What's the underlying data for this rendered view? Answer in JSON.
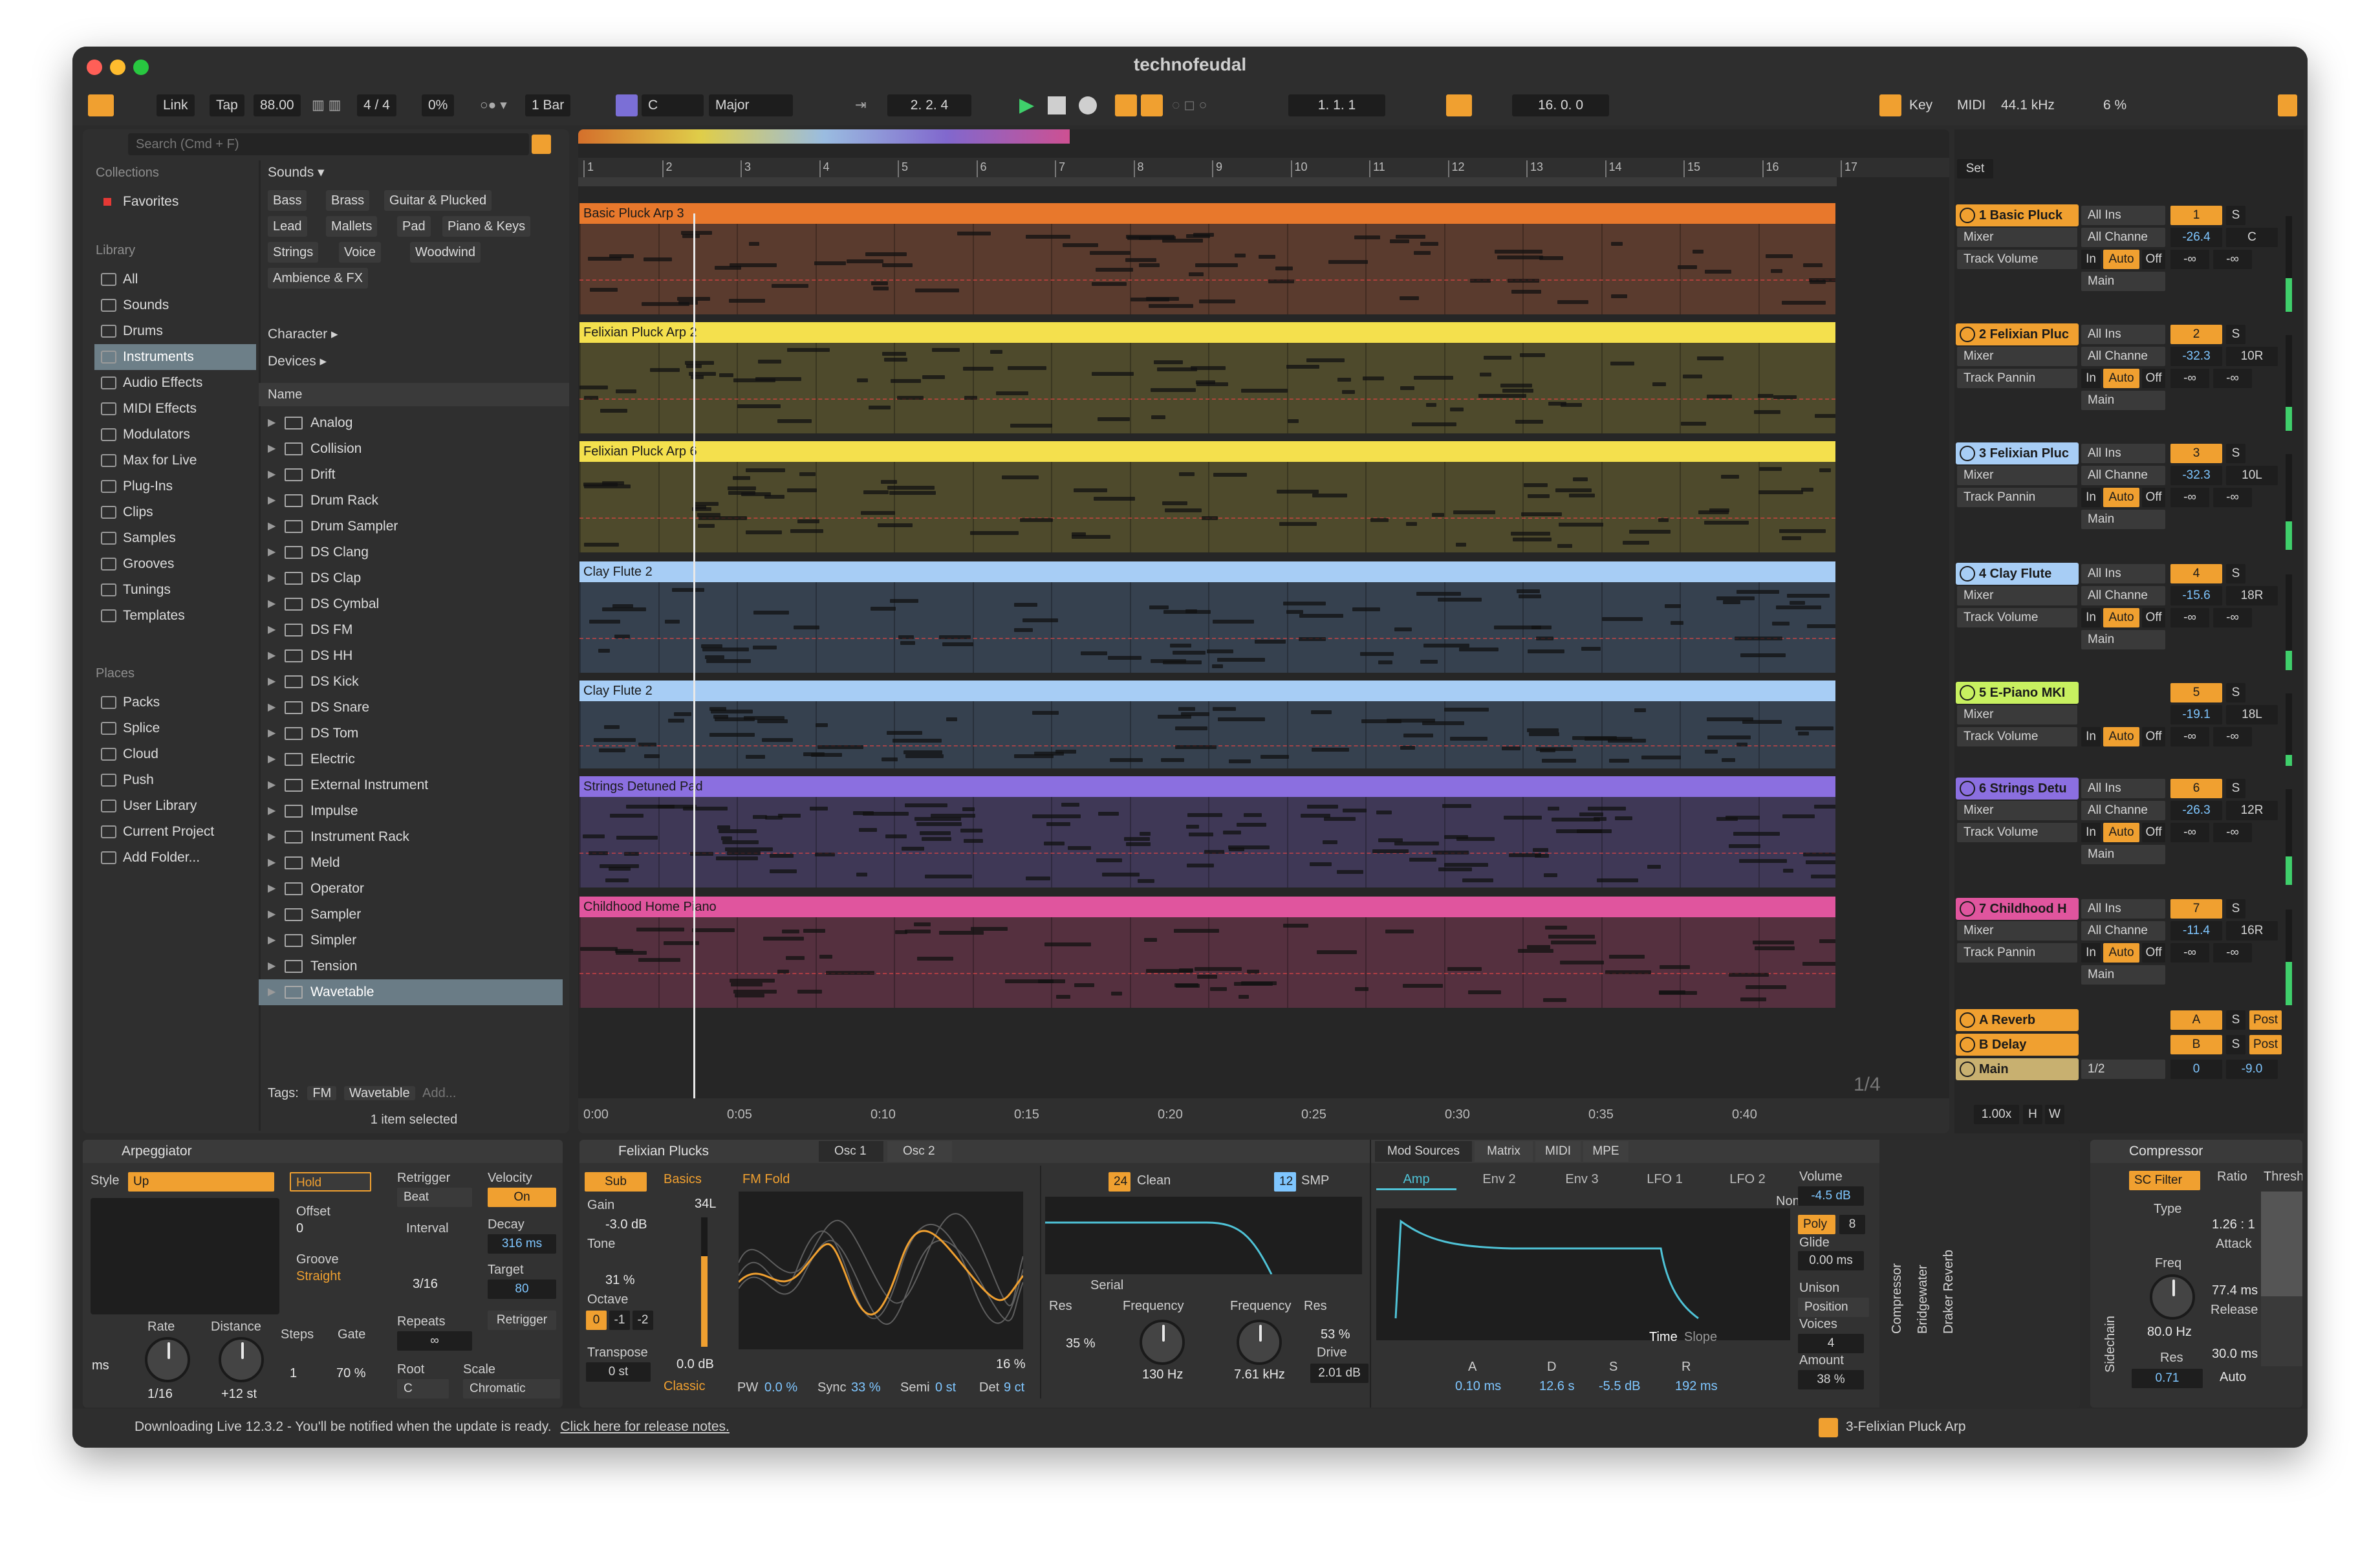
{
  "window": {
    "title": "technofeudal"
  },
  "control_bar": {
    "link": "Link",
    "tap": "Tap",
    "tempo": "88.00",
    "signature": "4 / 4",
    "swing": "0%",
    "quantize": "1 Bar",
    "key": "C",
    "scale": "Major",
    "position": "2.  2.  4",
    "loop_start": "1.  1.  1",
    "loop_length": "16.  0.  0",
    "key_map": "Key",
    "midi_map": "MIDI",
    "sample_rate": "44.1 kHz",
    "cpu": "6 %"
  },
  "browser": {
    "search_placeholder": "Search (Cmd + F)",
    "collections_head": "Collections",
    "favorites": "Favorites",
    "library_head": "Library",
    "library": [
      "All",
      "Sounds",
      "Drums",
      "Instruments",
      "Audio Effects",
      "MIDI Effects",
      "Modulators",
      "Max for Live",
      "Plug-Ins",
      "Clips",
      "Samples",
      "Grooves",
      "Tunings",
      "Templates"
    ],
    "places_head": "Places",
    "places": [
      "Packs",
      "Splice",
      "Cloud",
      "Push",
      "User Library",
      "Current Project",
      "Add Folder..."
    ],
    "sounds_head": "Sounds ▾",
    "sound_chips": [
      "Bass",
      "Brass",
      "Guitar & Plucked",
      "Lead",
      "Mallets",
      "Pad",
      "Piano & Keys",
      "Strings",
      "Voice",
      "Woodwind",
      "Ambience & FX"
    ],
    "character": "Character ▸",
    "devices_head": "Devices ▸",
    "name_col": "Name",
    "items": [
      "Analog",
      "Collision",
      "Drift",
      "Drum Rack",
      "Drum Sampler",
      "DS Clang",
      "DS Clap",
      "DS Cymbal",
      "DS FM",
      "DS HH",
      "DS Kick",
      "DS Snare",
      "DS Tom",
      "Electric",
      "External Instrument",
      "Impulse",
      "Instrument Rack",
      "Meld",
      "Operator",
      "Sampler",
      "Simpler",
      "Tension",
      "Wavetable"
    ],
    "tags_label": "Tags:",
    "tags": [
      "FM",
      "Wavetable",
      "Add..."
    ],
    "selection": "1 item selected"
  },
  "arrangement": {
    "bars": [
      "1",
      "2",
      "3",
      "4",
      "5",
      "6",
      "7",
      "8",
      "9",
      "10",
      "11",
      "12",
      "13",
      "14",
      "15",
      "16",
      "17"
    ],
    "times": [
      "0:00",
      "0:05",
      "0:10",
      "0:15",
      "0:20",
      "0:25",
      "0:30",
      "0:35",
      "0:40"
    ],
    "grid": "1/4",
    "clips": [
      {
        "name": "Basic Pluck Arp 3",
        "color": "#e8782c",
        "bg": "#5a3b2e"
      },
      {
        "name": "Felixian Pluck Arp 2",
        "color": "#f4e04d",
        "bg": "#4e4a2c"
      },
      {
        "name": "Felixian Pluck Arp 6",
        "color": "#f4e04d",
        "bg": "#4e4a2c"
      },
      {
        "name": "Clay Flute 2",
        "color": "#a7cdf5",
        "bg": "#36414f"
      },
      {
        "name": "Clay Flute 2",
        "color": "#a7cdf5",
        "bg": "#36414f"
      },
      {
        "name": "Strings Detuned Pad",
        "color": "#8b6fe0",
        "bg": "#3f3856"
      },
      {
        "name": "Childhood Home Piano",
        "color": "#e0559e",
        "bg": "#55303f"
      }
    ]
  },
  "mixer": {
    "set": "Set",
    "tracks": [
      {
        "name": "1 Basic Pluck",
        "color": "#f0a030",
        "input": "All Ins",
        "device": "Mixer",
        "chan": "All Channe",
        "param": "Track Volume",
        "num": "1",
        "vol": "-26.4",
        "pan": "C",
        "monitor": "Main",
        "meter": 0.35
      },
      {
        "name": "2 Felixian Pluc",
        "color": "#f0a030",
        "input": "All Ins",
        "device": "Mixer",
        "chan": "All Channe",
        "param": "Track Pannin",
        "num": "2",
        "vol": "-32.3",
        "pan": "10R",
        "monitor": "Main",
        "meter": 0.25
      },
      {
        "name": "3 Felixian Pluc",
        "color": "#a7cdf5",
        "input": "All Ins",
        "device": "Mixer",
        "chan": "All Channe",
        "param": "Track Pannin",
        "num": "3",
        "vol": "-32.3",
        "pan": "10L",
        "monitor": "Main",
        "meter": 0.3
      },
      {
        "name": "4 Clay Flute",
        "color": "#a7cdf5",
        "input": "All Ins",
        "device": "Mixer",
        "chan": "All Channe",
        "param": "Track Volume",
        "num": "4",
        "vol": "-15.6",
        "pan": "18R",
        "monitor": "Main",
        "meter": 0.2
      },
      {
        "name": "5 E-Piano MKI",
        "color": "#c8f060",
        "input": "",
        "device": "Mixer",
        "chan": "",
        "param": "Track Volume",
        "num": "5",
        "vol": "-19.1",
        "pan": "18L",
        "monitor": "Main",
        "meter": 0.15
      },
      {
        "name": "6 Strings Detu",
        "color": "#8b6fe0",
        "input": "All Ins",
        "device": "Mixer",
        "chan": "All Channe",
        "param": "Track Volume",
        "num": "6",
        "vol": "-26.3",
        "pan": "12R",
        "monitor": "Main",
        "meter": 0.3
      },
      {
        "name": "7 Childhood H",
        "color": "#e0559e",
        "input": "All Ins",
        "device": "Mixer",
        "chan": "All Channe",
        "param": "Track Pannin",
        "num": "7",
        "vol": "-11.4",
        "pan": "16R",
        "monitor": "Main",
        "meter": 0.45
      }
    ],
    "returns": [
      {
        "name": "A Reverb",
        "num": "A",
        "post": "Post"
      },
      {
        "name": "B Delay",
        "num": "B",
        "post": "Post"
      }
    ],
    "main": {
      "name": "Main",
      "ratio": "1/2",
      "num": "0",
      "vol": "-9.0"
    },
    "solo": "S",
    "in": "In",
    "auto": "Auto",
    "off": "Off",
    "inf": "-∞",
    "zoom": "1.00x",
    "h": "H",
    "w": "W"
  },
  "devices": {
    "arp": {
      "title": "Arpeggiator",
      "style_label": "Style",
      "style": "Up",
      "hold": "Hold",
      "offset_label": "Offset",
      "offset": "0",
      "groove_label": "Groove",
      "groove": "Straight",
      "rate_label": "Rate",
      "rate": "1/16",
      "distance_label": "Distance",
      "distance": "+12 st",
      "steps_label": "Steps",
      "steps": "1",
      "gate_label": "Gate",
      "gate": "70 %",
      "ms": "ms",
      "retrigger_label": "Retrigger",
      "retrigger": "Beat",
      "interval_label": "Interval",
      "interval": "3/16",
      "repeats_label": "Repeats",
      "repeats": "∞",
      "root_label": "Root",
      "root": "C",
      "scale_label": "Scale",
      "scale": "Chromatic",
      "velocity_label": "Velocity",
      "velocity": "On",
      "decay_label": "Decay",
      "decay": "316 ms",
      "target_label": "Target",
      "target": "80",
      "retrig_btn": "Retrigger"
    },
    "wt": {
      "title": "Felixian Plucks",
      "osc1": "Osc 1",
      "osc2": "Osc 2",
      "sub": "Sub",
      "gain_label": "Gain",
      "gain": "-3.0 dB",
      "tone_label": "Tone",
      "tone": "31 %",
      "octave_label": "Octave",
      "oct": [
        "0",
        "-1",
        "-2"
      ],
      "transpose_label": "Transpose",
      "transpose": "0 st",
      "basics": "Basics",
      "fmfold": "FM Fold",
      "pan": "34L",
      "level": "0.0 dB",
      "classic": "Classic",
      "pw": "PW",
      "pw_val": "0.0 %",
      "sync": "Sync",
      "sync_val": "33 %",
      "semi": "Semi",
      "semi_val": "0 st",
      "det": "Det",
      "det_val": "9 ct",
      "osc_pct": "16 %",
      "filter_slope": "24",
      "filter_type": "Clean",
      "filter2_slope": "12",
      "filter2_type": "SMP",
      "serial": "Serial",
      "res_label": "Res",
      "res": "35 %",
      "freq_label": "Frequency",
      "freq": "130 Hz",
      "freq2_label": "Frequency",
      "freq2": "7.61 kHz",
      "res2_label": "Res",
      "res2": "53 %",
      "drive_label": "Drive",
      "drive": "2.01 dB",
      "mod_tabs": [
        "Mod Sources",
        "Matrix",
        "MIDI",
        "MPE"
      ],
      "env_tabs": [
        "Amp",
        "Env 2",
        "Env 3",
        "LFO 1",
        "LFO 2"
      ],
      "none": "None",
      "time": "Time",
      "slope": "Slope",
      "a": "A",
      "a_val": "0.10 ms",
      "d": "D",
      "d_val": "12.6 s",
      "s": "S",
      "s_val": "-5.5 dB",
      "r": "R",
      "r_val": "192 ms",
      "volume_label": "Volume",
      "volume": "-4.5 dB",
      "poly": "Poly",
      "voices_n": "8",
      "glide_label": "Glide",
      "glide": "0.00 ms",
      "unison_label": "Unison",
      "unison": "Position",
      "voices_label": "Voices",
      "voices": "4",
      "amount_label": "Amount",
      "amount": "38 %"
    },
    "rack": [
      "Compressor",
      "Bridgewater",
      "Draker Reverb"
    ],
    "comp": {
      "title": "Compressor",
      "sc": "SC Filter",
      "type_label": "Type",
      "ratio_label": "Ratio",
      "ratio": "1.26 : 1",
      "attack_label": "Attack",
      "attack": "77.4 ms",
      "release_label": "Release",
      "release": "30.0 ms",
      "auto": "Auto",
      "freq_label": "Freq",
      "freq": "80.0 Hz",
      "res_label": "Res",
      "res": "0.71",
      "thresh": "Thresh",
      "sidechain": "Sidechain"
    }
  },
  "status": {
    "msg": "Downloading Live 12.3.2 - You'll be notified when the update is ready.",
    "link": "Click here for release notes.",
    "clip": "3-Felixian Pluck Arp"
  }
}
